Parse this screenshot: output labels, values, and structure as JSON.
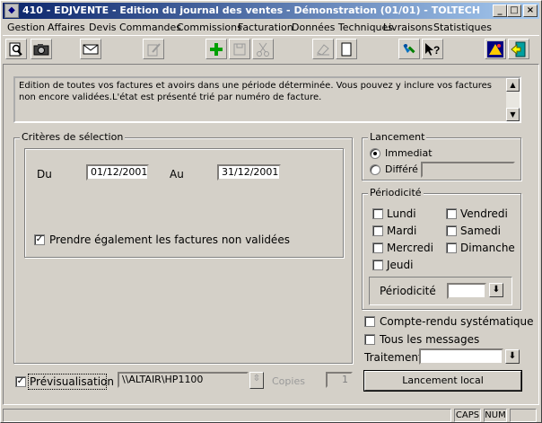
{
  "window": {
    "title": "410 - EDJVENTE - Edition du journal des ventes - Démonstration (01/01) - TOLTECH",
    "minimize": "_",
    "maximize": "□",
    "close": "×"
  },
  "menu": [
    "Gestion",
    "Affaires",
    "Devis",
    "Commandes",
    "Commissions",
    "Facturation",
    "Données Techniques",
    "Livraisons",
    "Statistiques"
  ],
  "toolbar": {
    "icons": [
      "preview-icon",
      "camera-icon",
      "mail-icon",
      "edit-doc-icon",
      "add-icon",
      "save-icon",
      "cut-icon",
      "erase-icon",
      "new-page-icon",
      "tools-icon",
      "help-icon",
      "logo-icon",
      "exit-icon"
    ]
  },
  "description": "Edition de toutes vos factures et avoirs dans une période déterminée. Vous pouvez y inclure vos factures non encore validées.L'état est présenté trié par numéro de facture.",
  "criteria": {
    "legend": "Critères de sélection",
    "du_label": "Du",
    "du_value": "01/12/2001",
    "au_label": "Au",
    "au_value": "31/12/2001",
    "include_label": "Prendre également les factures non validées",
    "include_checked": "✓"
  },
  "lancement": {
    "legend": "Lancement",
    "immediat": "Immediat",
    "differe": "Différé"
  },
  "periodicite": {
    "legend": "Périodicité",
    "days_left": [
      "Lundi",
      "Mardi",
      "Mercredi",
      "Jeudi"
    ],
    "days_right": [
      "Vendredi",
      "Samedi",
      "Dimanche"
    ],
    "label": "Périodicité",
    "value": ""
  },
  "options": {
    "compte_rendu": "Compte-rendu systématique",
    "tous_messages": "Tous les messages",
    "traitement_label": "Traitement",
    "traitement_value": ""
  },
  "launch_button": "Lancement local",
  "preview": {
    "label": "Prévisualisation",
    "checked": "✓",
    "printer": "\\\\ALTAIR\\HP1100",
    "copies_label": "Copies",
    "copies_value": "1"
  },
  "statusbar": {
    "caps": "CAPS",
    "num": "NUM"
  }
}
